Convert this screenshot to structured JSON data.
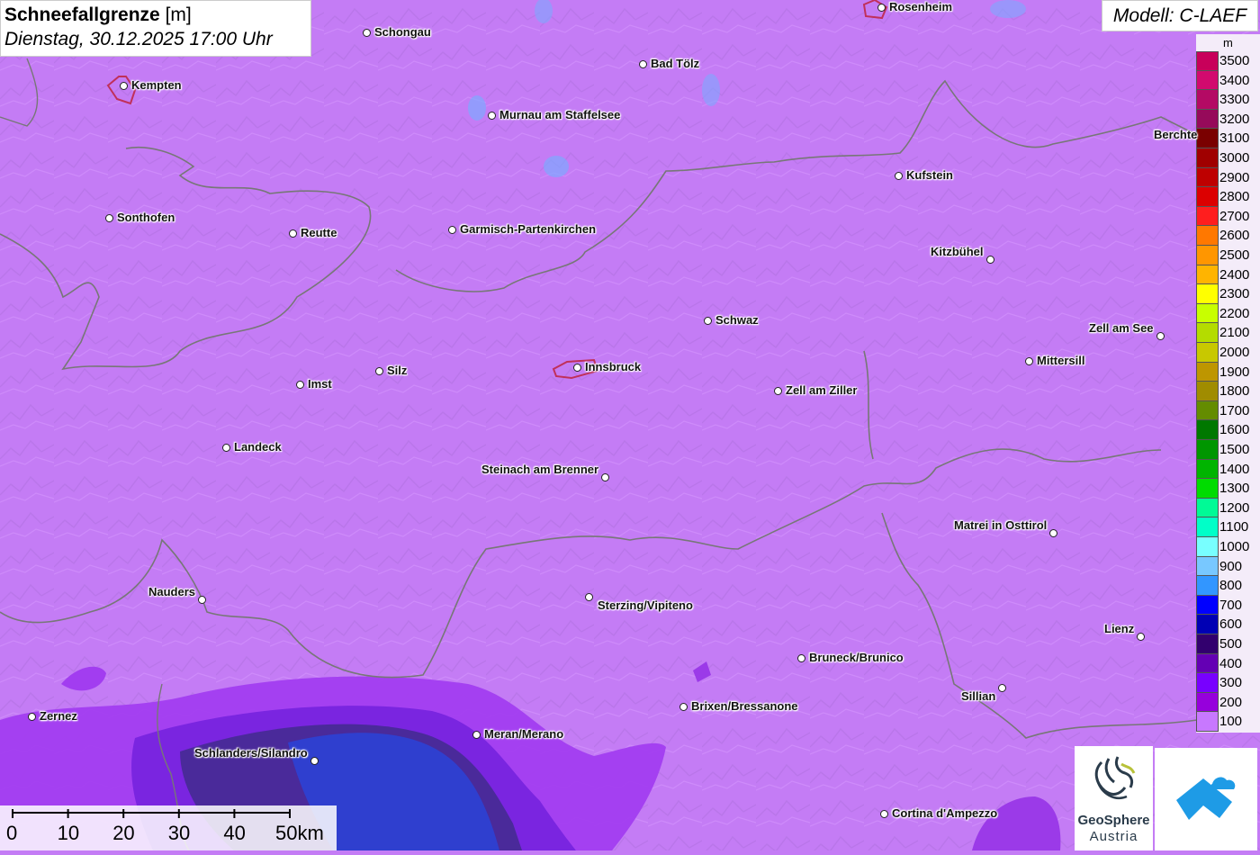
{
  "header": {
    "title_bold": "Schneefallgrenze",
    "title_unit": "[m]",
    "datetime": "Dienstag, 30.12.2025 17:00 Uhr",
    "model": "Modell: C-LAEF"
  },
  "legend": {
    "unit": "m",
    "entries": [
      {
        "label": "3500",
        "color": "#c8005a"
      },
      {
        "label": "3400",
        "color": "#d20a6e"
      },
      {
        "label": "3300",
        "color": "#b40a64"
      },
      {
        "label": "3200",
        "color": "#960a5a"
      },
      {
        "label": "3100",
        "color": "#7a0000"
      },
      {
        "label": "3000",
        "color": "#a00000"
      },
      {
        "label": "2900",
        "color": "#be0000"
      },
      {
        "label": "2800",
        "color": "#dc0000"
      },
      {
        "label": "2700",
        "color": "#ff1e1e"
      },
      {
        "label": "2600",
        "color": "#ff7800"
      },
      {
        "label": "2500",
        "color": "#ff9600"
      },
      {
        "label": "2400",
        "color": "#ffb400"
      },
      {
        "label": "2300",
        "color": "#ffff00"
      },
      {
        "label": "2200",
        "color": "#c8ff00"
      },
      {
        "label": "2100",
        "color": "#b4dc00"
      },
      {
        "label": "2000",
        "color": "#c8c800"
      },
      {
        "label": "1900",
        "color": "#be9600"
      },
      {
        "label": "1800",
        "color": "#a08c00"
      },
      {
        "label": "1700",
        "color": "#648c00"
      },
      {
        "label": "1600",
        "color": "#007800"
      },
      {
        "label": "1500",
        "color": "#009600"
      },
      {
        "label": "1400",
        "color": "#00b400"
      },
      {
        "label": "1300",
        "color": "#00dc00"
      },
      {
        "label": "1200",
        "color": "#00fa96"
      },
      {
        "label": "1100",
        "color": "#00ffc8"
      },
      {
        "label": "1000",
        "color": "#78ffff"
      },
      {
        "label": "900",
        "color": "#78c8ff"
      },
      {
        "label": "800",
        "color": "#3296ff"
      },
      {
        "label": "700",
        "color": "#0000ff"
      },
      {
        "label": "600",
        "color": "#0000b4"
      },
      {
        "label": "500",
        "color": "#32006e"
      },
      {
        "label": "400",
        "color": "#6400b4"
      },
      {
        "label": "300",
        "color": "#7800ff"
      },
      {
        "label": "200",
        "color": "#9600dc"
      },
      {
        "label": "100",
        "color": "#c878ff"
      }
    ]
  },
  "cities": [
    {
      "name": "Rosenheim"
    },
    {
      "name": "Schongau"
    },
    {
      "name": "Kempten"
    },
    {
      "name": "Bad Tölz"
    },
    {
      "name": "Murnau am Staffelsee"
    },
    {
      "name": "Berchte"
    },
    {
      "name": "Kufstein"
    },
    {
      "name": "Sonthofen"
    },
    {
      "name": "Reutte"
    },
    {
      "name": "Garmisch-Partenkirchen"
    },
    {
      "name": "Kitzbühel"
    },
    {
      "name": "Schwaz"
    },
    {
      "name": "Zell am See"
    },
    {
      "name": "Mittersill"
    },
    {
      "name": "Silz"
    },
    {
      "name": "Innsbruck"
    },
    {
      "name": "Imst"
    },
    {
      "name": "Zell am Ziller"
    },
    {
      "name": "Landeck"
    },
    {
      "name": "Steinach am Brenner"
    },
    {
      "name": "Matrei in Osttirol"
    },
    {
      "name": "Nauders"
    },
    {
      "name": "Sterzing/Vipiteno"
    },
    {
      "name": "Lienz"
    },
    {
      "name": "Bruneck/Brunico"
    },
    {
      "name": "Sillian"
    },
    {
      "name": "Brixen/Bressanone"
    },
    {
      "name": "Zernez"
    },
    {
      "name": "Meran/Merano"
    },
    {
      "name": "Schlanders/Silandro"
    },
    {
      "name": "Cortina d'Ampezzo"
    }
  ],
  "scale": {
    "ticks": [
      "0",
      "10",
      "20",
      "30",
      "40",
      "50km"
    ]
  },
  "logos": {
    "geosphere_name": "GeoSphere",
    "geosphere_sub": "Austria"
  },
  "colors": {
    "background": "#c47cf5",
    "border_lines": "#777777"
  }
}
